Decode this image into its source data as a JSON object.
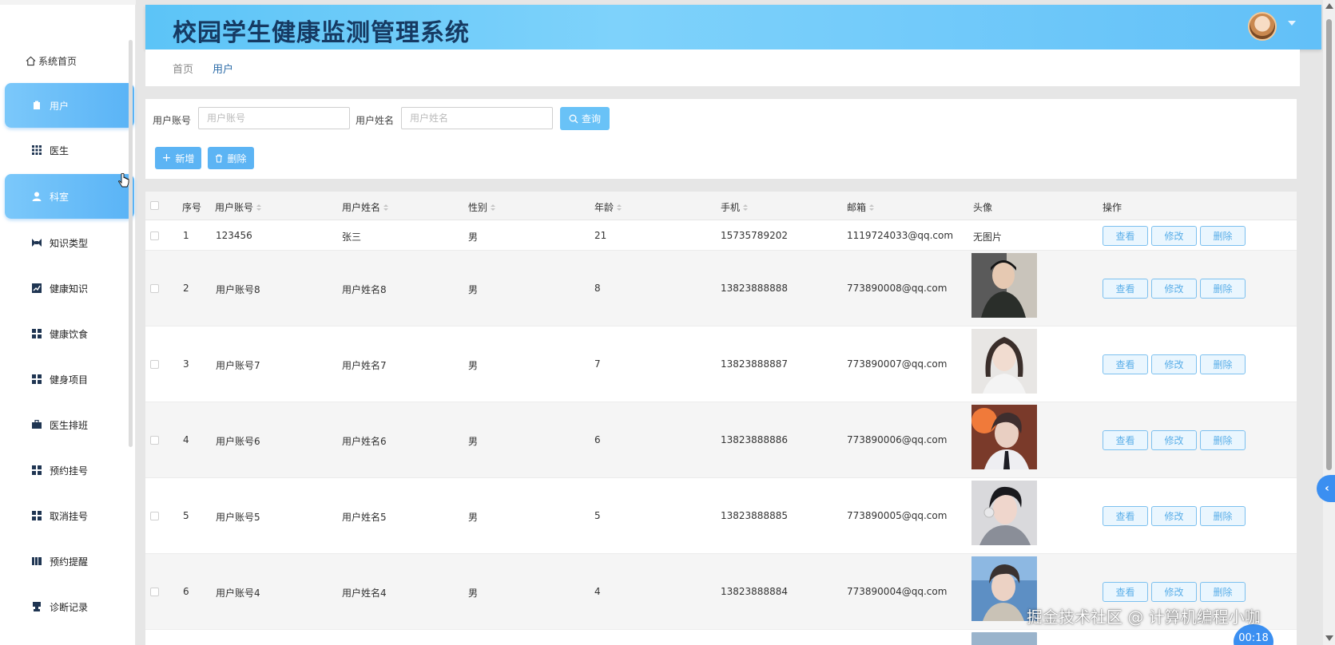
{
  "header": {
    "title": "校园学生健康监测管理系统"
  },
  "sidebar": {
    "home_label": "系统首页",
    "items": [
      {
        "label": "用户",
        "icon": "clipboard-icon",
        "active": true
      },
      {
        "label": "医生",
        "icon": "grid-icon",
        "active": false
      },
      {
        "label": "科室",
        "icon": "person-icon",
        "active": true
      },
      {
        "label": "知识类型",
        "icon": "chart-icon",
        "active": false
      },
      {
        "label": "健康知识",
        "icon": "trend-icon",
        "active": false
      },
      {
        "label": "健康饮食",
        "icon": "grid-icon",
        "active": false
      },
      {
        "label": "健身项目",
        "icon": "grid-icon",
        "active": false
      },
      {
        "label": "医生排班",
        "icon": "briefcase-icon",
        "active": false
      },
      {
        "label": "预约挂号",
        "icon": "grid-icon",
        "active": false
      },
      {
        "label": "取消挂号",
        "icon": "grid-icon",
        "active": false
      },
      {
        "label": "预约提醒",
        "icon": "book-icon",
        "active": false
      },
      {
        "label": "诊断记录",
        "icon": "stamp-icon",
        "active": false
      }
    ]
  },
  "breadcrumb": {
    "home": "首页",
    "current": "用户"
  },
  "search": {
    "account_label": "用户账号",
    "account_placeholder": "用户账号",
    "name_label": "用户姓名",
    "name_placeholder": "用户姓名",
    "search_button": "查询",
    "add_button": "新增",
    "delete_button": "删除"
  },
  "table": {
    "columns": [
      "序号",
      "用户账号",
      "用户姓名",
      "性别",
      "年龄",
      "手机",
      "邮箱",
      "头像",
      "操作"
    ],
    "actions": {
      "view": "查看",
      "edit": "修改",
      "delete": "删除"
    },
    "rows": [
      {
        "index": "1",
        "account": "123456",
        "name": "张三",
        "gender": "男",
        "age": "21",
        "phone": "15735789202",
        "email": "1119724033@qq.com",
        "avatar": "无图片"
      },
      {
        "index": "2",
        "account": "用户账号8",
        "name": "用户姓名8",
        "gender": "男",
        "age": "8",
        "phone": "13823888888",
        "email": "773890008@qq.com",
        "avatar": ""
      },
      {
        "index": "3",
        "account": "用户账号7",
        "name": "用户姓名7",
        "gender": "男",
        "age": "7",
        "phone": "13823888887",
        "email": "773890007@qq.com",
        "avatar": ""
      },
      {
        "index": "4",
        "account": "用户账号6",
        "name": "用户姓名6",
        "gender": "男",
        "age": "6",
        "phone": "13823888886",
        "email": "773890006@qq.com",
        "avatar": ""
      },
      {
        "index": "5",
        "account": "用户账号5",
        "name": "用户姓名5",
        "gender": "男",
        "age": "5",
        "phone": "13823888885",
        "email": "773890005@qq.com",
        "avatar": ""
      },
      {
        "index": "6",
        "account": "用户账号4",
        "name": "用户姓名4",
        "gender": "男",
        "age": "4",
        "phone": "13823888884",
        "email": "773890004@qq.com",
        "avatar": ""
      }
    ]
  },
  "watermark": "掘金技术社区 @ 计算机编程小咖",
  "timer": "00:18",
  "colors": {
    "accent": "#5cb4f4",
    "header": "#6ccaf9",
    "title": "#163a62"
  }
}
